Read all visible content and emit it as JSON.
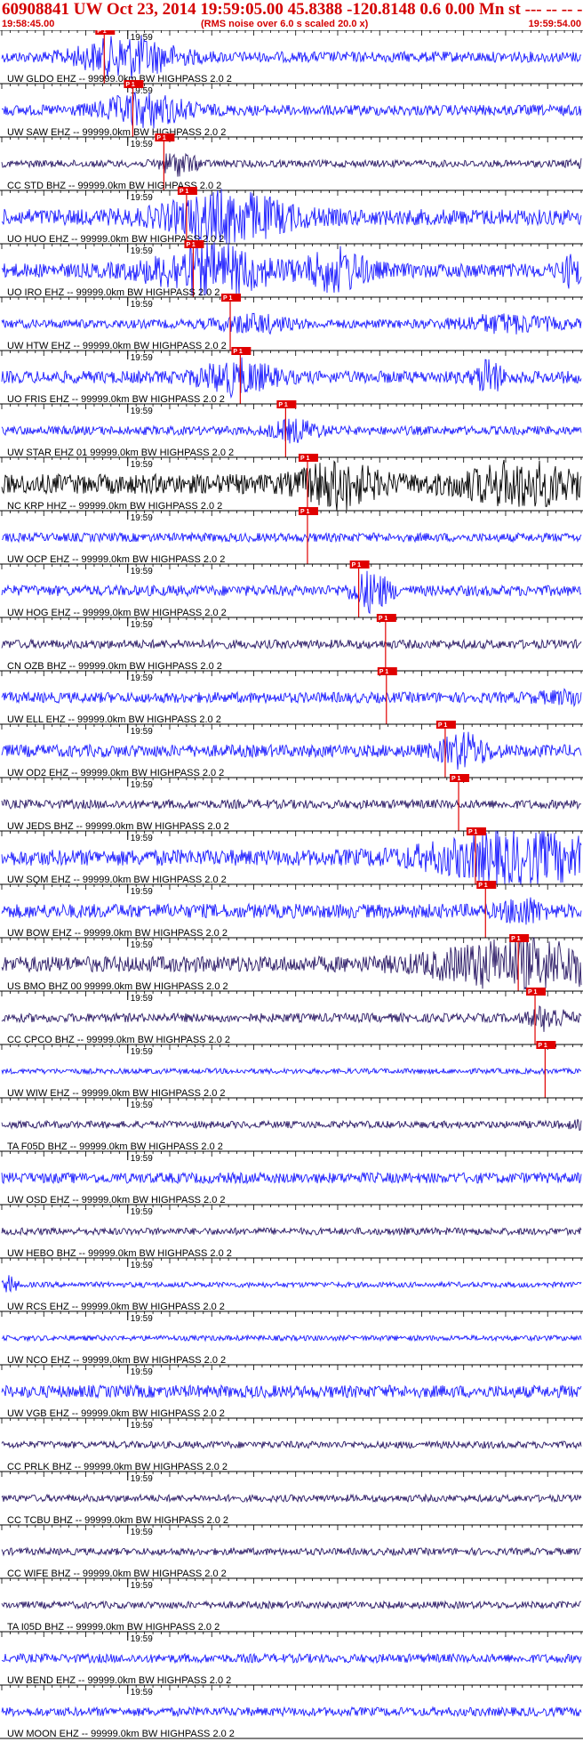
{
  "header": {
    "title": "60908841 UW Oct 23, 2014 19:59:05.00   45.8388 -120.8148  0.6 0.00 Mn st --- -- --  -1",
    "start_time": "19:58:45.00",
    "scale_note": "(RMS noise over 6.0 s scaled 20.0 x)",
    "end_time": "19:59:54.00"
  },
  "chart_data": {
    "type": "seismogram",
    "time_window": [
      "19:58:45.00",
      "19:59:54.00"
    ],
    "minute_label": "19:59",
    "pick_label": "P 1",
    "colors": {
      "blue": "#1c1cff",
      "black": "#000000",
      "navy": "#2b1a66",
      "pick": "#e00000"
    },
    "traces": [
      {
        "label": "UW GLDO EHZ -- 99999.0km BW  HIGHPASS  2.0  2",
        "color": "blue",
        "pick_s": 12.2,
        "noise": 0.3,
        "bursts": [
          [
            15,
            8,
            1.0
          ]
        ]
      },
      {
        "label": "UW SAW EHZ -- 99999.0km BW  HIGHPASS  2.0  2",
        "color": "blue",
        "pick_s": 15.6,
        "noise": 0.3,
        "bursts": [
          [
            17,
            7,
            0.8
          ]
        ]
      },
      {
        "label": "CC STD BHZ -- 99999.0km BW  HIGHPASS  2.0  2",
        "color": "navy",
        "pick_s": 19.3,
        "noise": 0.2,
        "bursts": [
          [
            21,
            3,
            0.6
          ],
          [
            71,
            3,
            0.5
          ]
        ]
      },
      {
        "label": "UO HUO EHZ -- 99999.0km BW  HIGHPASS  2.0  2",
        "color": "blue",
        "pick_s": 22.0,
        "noise": 0.45,
        "bursts": [
          [
            27,
            10,
            1.2
          ]
        ]
      },
      {
        "label": "UO IRO EHZ -- 99999.0km BW  HIGHPASS  2.0  2",
        "color": "blue",
        "pick_s": 22.8,
        "noise": 0.4,
        "bursts": [
          [
            25,
            10,
            1.2
          ],
          [
            40,
            5,
            1.0
          ],
          [
            68,
            2,
            0.7
          ]
        ]
      },
      {
        "label": "UW HTW EHZ -- 99999.0km BW  HIGHPASS  2.0  2",
        "color": "blue",
        "pick_s": 27.2,
        "noise": 0.25,
        "bursts": [
          [
            30,
            6,
            0.4
          ],
          [
            60,
            8,
            0.4
          ]
        ]
      },
      {
        "label": "UO FRIS EHZ -- 99999.0km BW  HIGHPASS  2.0  2",
        "color": "blue",
        "pick_s": 28.4,
        "noise": 0.35,
        "bursts": [
          [
            28,
            6,
            0.8
          ],
          [
            58,
            2,
            0.9
          ]
        ]
      },
      {
        "label": "UW STAR EHZ 01 99999.0km BW  HIGHPASS  2.0  2",
        "color": "blue",
        "pick_s": 33.8,
        "noise": 0.25,
        "bursts": [
          [
            35,
            4,
            0.5
          ]
        ]
      },
      {
        "label": "NC KRP HHZ -- 99999.0km BW  HIGHPASS  2.0  2",
        "color": "black",
        "pick_s": 36.4,
        "noise": 0.55,
        "bursts": [
          [
            40,
            6,
            1.0
          ],
          [
            62,
            10,
            0.9
          ],
          [
            96,
            4,
            0.9
          ]
        ]
      },
      {
        "label": "UW OCP EHZ -- 99999.0km BW  HIGHPASS  2.0  2",
        "color": "blue",
        "pick_s": 36.4,
        "noise": 0.25,
        "bursts": []
      },
      {
        "label": "UW HOG EHZ -- 99999.0km BW  HIGHPASS  2.0  2",
        "color": "blue",
        "pick_s": 42.5,
        "noise": 0.3,
        "bursts": [
          [
            44,
            3,
            1.0
          ]
        ]
      },
      {
        "label": "CN OZB BHZ -- 99999.0km BW  HIGHPASS  2.0  2",
        "color": "navy",
        "pick_s": 45.7,
        "noise": 0.25,
        "bursts": []
      },
      {
        "label": "UW ELL EHZ -- 99999.0km BW  HIGHPASS  2.0  2",
        "color": "blue",
        "pick_s": 45.8,
        "noise": 0.3,
        "bursts": [
          [
            74,
            10,
            0.6
          ],
          [
            88,
            8,
            0.55
          ]
        ]
      },
      {
        "label": "UW OD2 EHZ -- 99999.0km BW  HIGHPASS  2.0  2",
        "color": "blue",
        "pick_s": 52.8,
        "noise": 0.35,
        "bursts": [
          [
            55,
            4,
            0.8
          ]
        ]
      },
      {
        "label": "UW JEDS BHZ -- 99999.0km BW  HIGHPASS  2.0  2",
        "color": "navy",
        "pick_s": 54.4,
        "noise": 0.25,
        "bursts": []
      },
      {
        "label": "UW SQM EHZ -- 99999.0km BW  HIGHPASS  2.0  2",
        "color": "blue",
        "pick_s": 56.4,
        "noise": 0.45,
        "bursts": [
          [
            60,
            14,
            0.9
          ],
          [
            80,
            25,
            0.7
          ]
        ]
      },
      {
        "label": "UW BOW EHZ -- 99999.0km BW  HIGHPASS  2.0  2",
        "color": "blue",
        "pick_s": 57.6,
        "noise": 0.4,
        "bursts": [
          [
            62,
            3,
            0.6
          ]
        ]
      },
      {
        "label": "US BMO BHZ 00 99999.0km BW  HIGHPASS  2.0  2",
        "color": "navy",
        "pick_s": 61.5,
        "noise": 0.45,
        "bursts": [
          [
            60,
            12,
            1.0
          ],
          [
            82,
            22,
            1.0
          ]
        ]
      },
      {
        "label": "CC CPCO BHZ -- 99999.0km BW  HIGHPASS  2.0  2",
        "color": "navy",
        "pick_s": 63.5,
        "noise": 0.25,
        "bursts": [
          [
            65,
            3,
            0.6
          ]
        ]
      },
      {
        "label": "UW WIW EHZ -- 99999.0km BW  HIGHPASS  2.0  2",
        "color": "blue",
        "pick_s": 64.7,
        "noise": 0.15,
        "bursts": []
      },
      {
        "label": "TA F05D BHZ -- 99999.0km BW  HIGHPASS  2.0  2",
        "color": "navy",
        "pick_s": 72.6,
        "noise": 0.2,
        "bursts": [
          [
            78,
            9,
            1.0
          ]
        ]
      },
      {
        "label": "UW OSD EHZ -- 99999.0km BW  HIGHPASS  2.0  2",
        "color": "blue",
        "pick_s": 75.8,
        "noise": 0.3,
        "bursts": [
          [
            76,
            2,
            0.8
          ]
        ]
      },
      {
        "label": "UW HEBO BHZ -- 99999.0km BW  HIGHPASS  2.0  2",
        "color": "navy",
        "pick_s": 77.3,
        "noise": 0.2,
        "bursts": []
      },
      {
        "label": "UW RCS EHZ -- 99999.0km BW  HIGHPASS  2.0  2",
        "color": "blue",
        "pick_s": 78.7,
        "noise": 0.15,
        "bursts": [
          [
            1,
            1,
            0.5
          ],
          [
            80,
            1,
            0.4
          ]
        ]
      },
      {
        "label": "UW NCO EHZ -- 99999.0km BW  HIGHPASS  2.0  2",
        "color": "blue",
        "pick_s": 84.7,
        "noise": 0.15,
        "bursts": []
      },
      {
        "label": "UW VGB EHZ -- 99999.0km BW  HIGHPASS  2.0  2",
        "color": "blue",
        "pick_s": 89.4,
        "noise": 0.35,
        "bursts": [
          [
            92,
            4,
            1.1
          ],
          [
            84,
            1,
            0.9
          ]
        ]
      },
      {
        "label": "CC PRLK BHZ -- 99999.0km BW  HIGHPASS  2.0  2",
        "color": "navy",
        "pick_s": null,
        "noise": 0.2,
        "bursts": []
      },
      {
        "label": "CC TCBU BHZ -- 99999.0km BW  HIGHPASS  2.0  2",
        "color": "navy",
        "pick_s": null,
        "noise": 0.2,
        "bursts": []
      },
      {
        "label": "CC WIFE BHZ -- 99999.0km BW  HIGHPASS  2.0  2",
        "color": "navy",
        "pick_s": null,
        "noise": 0.2,
        "bursts": []
      },
      {
        "label": "TA I05D BHZ -- 99999.0km BW  HIGHPASS  2.0  2",
        "color": "navy",
        "pick_s": null,
        "noise": 0.2,
        "bursts": []
      },
      {
        "label": "UW BEND EHZ -- 99999.0km BW  HIGHPASS  2.0  2",
        "color": "blue",
        "pick_s": null,
        "noise": 0.25,
        "bursts": []
      },
      {
        "label": "UW MOON EHZ -- 99999.0km BW  HIGHPASS  2.0  2",
        "color": "blue",
        "pick_s": null,
        "noise": 0.25,
        "bursts": []
      }
    ]
  }
}
